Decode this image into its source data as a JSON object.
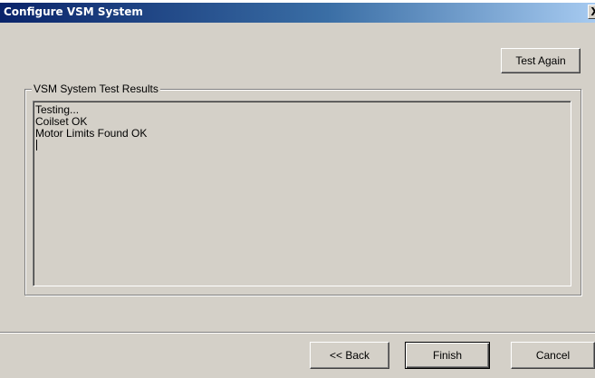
{
  "window": {
    "title": "Configure VSM System",
    "close_symbol": "X"
  },
  "buttons": {
    "test_again": "Test Again",
    "back": "<< Back",
    "finish": "Finish",
    "cancel": "Cancel"
  },
  "results_group": {
    "label": "VSM System Test Results",
    "lines": [
      "Testing...",
      "Coilset OK",
      "Motor Limits Found OK",
      ""
    ]
  },
  "icons": {
    "close": "close-icon"
  },
  "colors": {
    "titlebar_start": "#0a246a",
    "titlebar_end": "#a6caf0",
    "face": "#d4d0c8"
  }
}
